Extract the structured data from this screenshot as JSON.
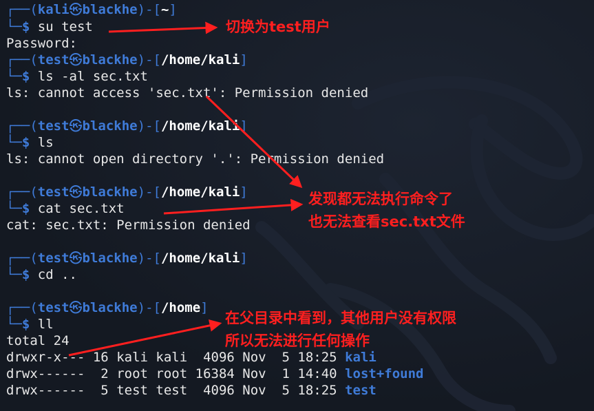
{
  "colors": {
    "background": "#161c26",
    "prompt_blue": "#3f7bd8",
    "text": "#e8e8e8",
    "annotation_red": "#ff1f1f"
  },
  "icons": {
    "at_symbol": "kali-skull-icon",
    "frame_top": "┌──(",
    "frame_bottom": "└─$",
    "dragon": "kali-dragon-watermark"
  },
  "blocks": [
    {
      "user": "kali",
      "host": "blackhe",
      "path": "~",
      "command": "su test",
      "output": [
        "Password:"
      ]
    },
    {
      "user": "test",
      "host": "blackhe",
      "path": "/home/kali",
      "command": "ls -al sec.txt",
      "output": [
        "ls: cannot access 'sec.txt': Permission denied"
      ]
    },
    {
      "user": "test",
      "host": "blackhe",
      "path": "/home/kali",
      "command": "ls",
      "output": [
        "ls: cannot open directory '.': Permission denied"
      ]
    },
    {
      "user": "test",
      "host": "blackhe",
      "path": "/home/kali",
      "command": "cat sec.txt",
      "output": [
        "cat: sec.txt: Permission denied"
      ]
    },
    {
      "user": "test",
      "host": "blackhe",
      "path": "/home/kali",
      "command": "cd ..",
      "output": []
    },
    {
      "user": "test",
      "host": "blackhe",
      "path": "/home",
      "command": "ll",
      "output": [
        "total 24"
      ]
    }
  ],
  "listing": [
    {
      "perms": "drwxr-x---",
      "links": "16",
      "owner": "kali",
      "group": "kali",
      "size": " 4096",
      "month": "Nov",
      "day": " 5",
      "time": "18:25",
      "name": "kali"
    },
    {
      "perms": "drwx------",
      "links": " 2",
      "owner": "root",
      "group": "root",
      "size": "16384",
      "month": "Nov",
      "day": " 1",
      "time": "14:40",
      "name": "lost+found"
    },
    {
      "perms": "drwx------",
      "links": " 5",
      "owner": "test",
      "group": "test",
      "size": " 4096",
      "month": "Nov",
      "day": " 5",
      "time": "18:25",
      "name": "test"
    }
  ],
  "annotations": {
    "switch_user": "切换为test用户",
    "cannot_exec_1": "发现都无法执行命令了",
    "cannot_exec_2": "也无法查看sec.txt文件",
    "parent_dir_1": "在父目录中看到，其他用户没有权限",
    "parent_dir_2": "所以无法进行任何操作"
  }
}
